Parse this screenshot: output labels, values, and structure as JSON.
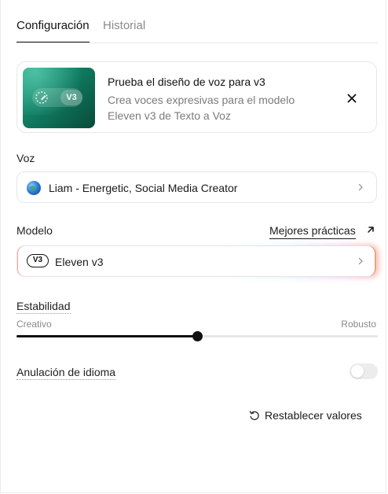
{
  "tabs": [
    {
      "label": "Configuración",
      "active": true
    },
    {
      "label": "Historial",
      "active": false
    }
  ],
  "promo": {
    "badge": "V3",
    "title": "Prueba el diseño de voz para v3",
    "description": "Crea voces expresivas para el modelo Eleven v3 de Texto a Voz"
  },
  "voice": {
    "label": "Voz",
    "value": "Liam - Energetic, Social Media Creator",
    "icon": "globe-icon"
  },
  "model": {
    "label": "Modelo",
    "link": "Mejores prácticas",
    "badge": "V3",
    "value": "Eleven v3"
  },
  "stability": {
    "label": "Estabilidad",
    "min_label": "Creativo",
    "max_label": "Robusto",
    "value_fraction": 0.5
  },
  "language_override": {
    "label": "Anulación de idioma",
    "enabled": false
  },
  "reset": {
    "label": "Restablecer valores"
  },
  "colors": {
    "accent": "#111111",
    "promo_gradient_start": "#1d9a7d",
    "promo_gradient_end": "#0a4a3a",
    "model_glow_end": "#f3a07e"
  }
}
